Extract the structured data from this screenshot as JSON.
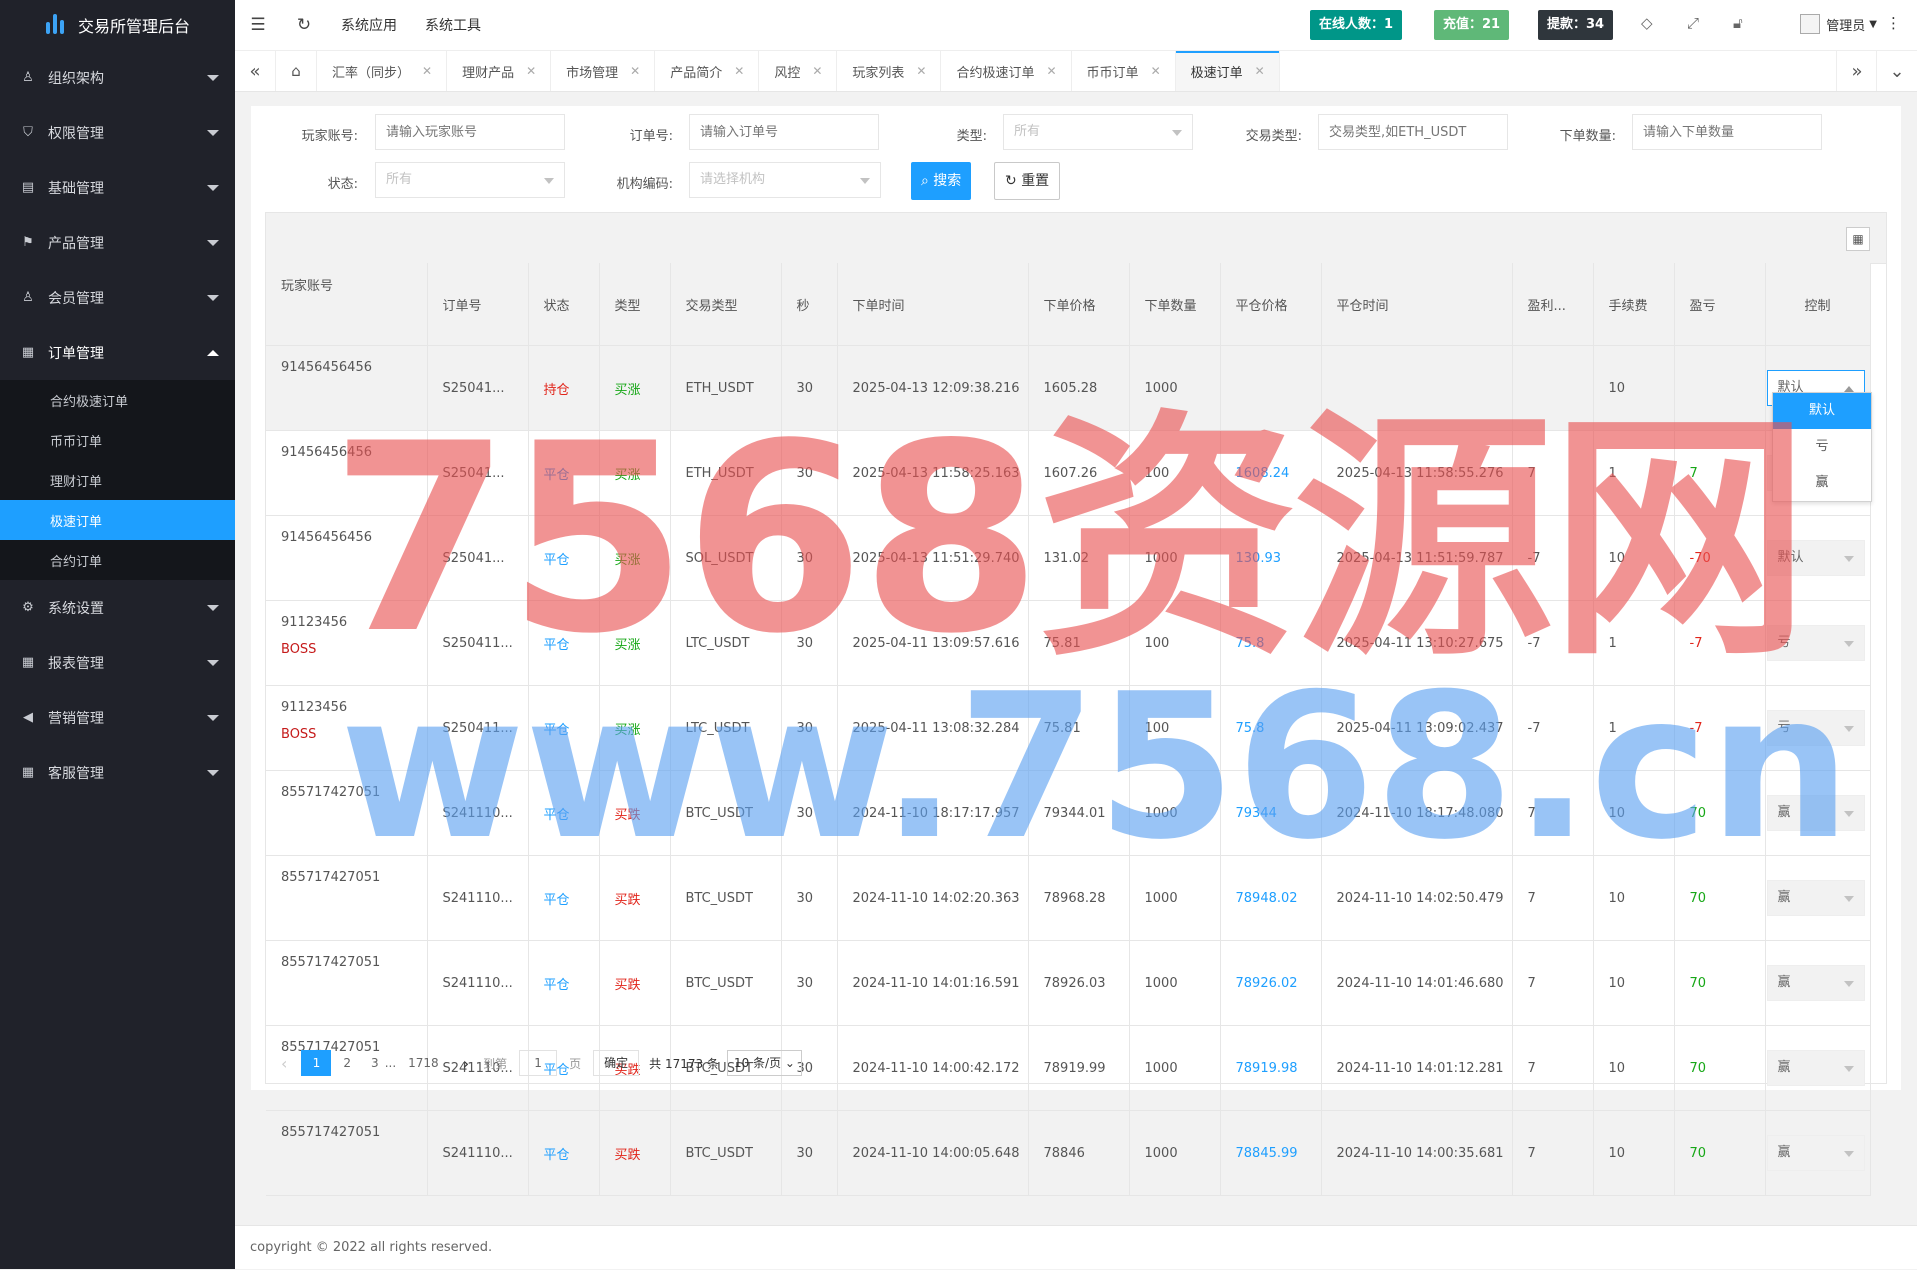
{
  "app": {
    "title": "交易所管理后台"
  },
  "sidebar": {
    "menus": [
      {
        "label": "组织架构",
        "icon": "user-icon"
      },
      {
        "label": "权限管理",
        "icon": "shield-icon"
      },
      {
        "label": "基础管理",
        "icon": "database-icon"
      },
      {
        "label": "产品管理",
        "icon": "flag-icon"
      },
      {
        "label": "会员管理",
        "icon": "person-icon"
      },
      {
        "label": "订单管理",
        "icon": "grid-icon"
      },
      {
        "label": "系统设置",
        "icon": "gear-icon"
      },
      {
        "label": "报表管理",
        "icon": "report-icon"
      },
      {
        "label": "营销管理",
        "icon": "megaphone-icon"
      },
      {
        "label": "客服管理",
        "icon": "apps-icon"
      }
    ],
    "order_sub": [
      "合约极速订单",
      "币币订单",
      "理财订单",
      "极速订单",
      "合约订单"
    ]
  },
  "header": {
    "links": [
      "系统应用",
      "系统工具"
    ],
    "online": "在线人数：1",
    "recharge": "充值：21",
    "withdraw": "提款：34",
    "admin": "管理员"
  },
  "tabs": [
    "汇率（同步）",
    "理财产品",
    "市场管理",
    "产品简介",
    "风控",
    "玩家列表",
    "合约极速订单",
    "币币订单",
    "极速订单"
  ],
  "filters": {
    "player_label": "玩家账号:",
    "player_ph": "请输入玩家账号",
    "order_label": "订单号:",
    "order_ph": "请输入订单号",
    "type_label": "类型:",
    "type_value": "所有",
    "trade_label": "交易类型:",
    "trade_ph": "交易类型,如ETH_USDT",
    "qty_label": "下单数量:",
    "qty_ph": "请输入下单数量",
    "status_label": "状态:",
    "status_value": "所有",
    "org_label": "机构编码:",
    "org_value": "请选择机构",
    "search": "搜索",
    "reset": "重置"
  },
  "table": {
    "headers": [
      "玩家账号",
      "订单号",
      "状态",
      "类型",
      "交易类型",
      "秒",
      "下单时间",
      "下单价格",
      "下单数量",
      "平仓价格",
      "平仓时间",
      "盈利...",
      "手续费",
      "盈亏",
      "控制"
    ],
    "rows": [
      {
        "acct": "91456456456",
        "tag": "",
        "order": "S25041...",
        "status": "持仓",
        "type": "买涨",
        "pair": "ETH_USDT",
        "sec": "30",
        "otime": "2025-04-13 12:09:38.216",
        "oprice": "1605.28",
        "qty": "1000",
        "cprice": "",
        "ctime": "",
        "profit": "",
        "fee": "10",
        "pnl": "",
        "ctrl": "默认"
      },
      {
        "acct": "91456456456",
        "tag": "",
        "order": "S25041...",
        "status": "平仓",
        "type": "买涨",
        "pair": "ETH_USDT",
        "sec": "30",
        "otime": "2025-04-13 11:58:25.163",
        "oprice": "1607.26",
        "qty": "100",
        "cprice": "1608.24",
        "ctime": "2025-04-13 11:58:55.276",
        "profit": "7",
        "fee": "1",
        "pnl": "7",
        "ctrl": "默认"
      },
      {
        "acct": "91456456456",
        "tag": "",
        "order": "S25041...",
        "status": "平仓",
        "type": "买涨",
        "pair": "SOL_USDT",
        "sec": "30",
        "otime": "2025-04-13 11:51:29.740",
        "oprice": "131.02",
        "qty": "1000",
        "cprice": "130.93",
        "ctime": "2025-04-13 11:51:59.787",
        "profit": "-7",
        "fee": "10",
        "pnl": "-70",
        "ctrl": "默认"
      },
      {
        "acct": "91123456",
        "tag": "BOSS",
        "order": "S250411...",
        "status": "平仓",
        "type": "买涨",
        "pair": "LTC_USDT",
        "sec": "30",
        "otime": "2025-04-11 13:09:57.616",
        "oprice": "75.81",
        "qty": "100",
        "cprice": "75.8",
        "ctime": "2025-04-11 13:10:27.675",
        "profit": "-7",
        "fee": "1",
        "pnl": "-7",
        "ctrl": "亏"
      },
      {
        "acct": "91123456",
        "tag": "BOSS",
        "order": "S250411...",
        "status": "平仓",
        "type": "买涨",
        "pair": "LTC_USDT",
        "sec": "30",
        "otime": "2025-04-11 13:08:32.284",
        "oprice": "75.81",
        "qty": "100",
        "cprice": "75.8",
        "ctime": "2025-04-11 13:09:02.437",
        "profit": "-7",
        "fee": "1",
        "pnl": "-7",
        "ctrl": "亏"
      },
      {
        "acct": "855717427051",
        "tag": "",
        "order": "S241110...",
        "status": "平仓",
        "type": "买跌",
        "pair": "BTC_USDT",
        "sec": "30",
        "otime": "2024-11-10 18:17:17.957",
        "oprice": "79344.01",
        "qty": "1000",
        "cprice": "79344",
        "ctime": "2024-11-10 18:17:48.080",
        "profit": "7",
        "fee": "10",
        "pnl": "70",
        "ctrl": "赢"
      },
      {
        "acct": "855717427051",
        "tag": "",
        "order": "S241110...",
        "status": "平仓",
        "type": "买跌",
        "pair": "BTC_USDT",
        "sec": "30",
        "otime": "2024-11-10 14:02:20.363",
        "oprice": "78968.28",
        "qty": "1000",
        "cprice": "78948.02",
        "ctime": "2024-11-10 14:02:50.479",
        "profit": "7",
        "fee": "10",
        "pnl": "70",
        "ctrl": "赢"
      },
      {
        "acct": "855717427051",
        "tag": "",
        "order": "S241110...",
        "status": "平仓",
        "type": "买跌",
        "pair": "BTC_USDT",
        "sec": "30",
        "otime": "2024-11-10 14:01:16.591",
        "oprice": "78926.03",
        "qty": "1000",
        "cprice": "78926.02",
        "ctime": "2024-11-10 14:01:46.680",
        "profit": "7",
        "fee": "10",
        "pnl": "70",
        "ctrl": "赢"
      },
      {
        "acct": "855717427051",
        "tag": "",
        "order": "S241110...",
        "status": "平仓",
        "type": "买跌",
        "pair": "BTC_USDT",
        "sec": "30",
        "otime": "2024-11-10 14:00:42.172",
        "oprice": "78919.99",
        "qty": "1000",
        "cprice": "78919.98",
        "ctime": "2024-11-10 14:01:12.281",
        "profit": "7",
        "fee": "10",
        "pnl": "70",
        "ctrl": "赢"
      },
      {
        "acct": "855717427051",
        "tag": "",
        "order": "S241110...",
        "status": "平仓",
        "type": "买跌",
        "pair": "BTC_USDT",
        "sec": "30",
        "otime": "2024-11-10 14:00:05.648",
        "oprice": "78846",
        "qty": "1000",
        "cprice": "78845.99",
        "ctime": "2024-11-10 14:00:35.681",
        "profit": "7",
        "fee": "10",
        "pnl": "70",
        "ctrl": "赢"
      }
    ]
  },
  "dropdown_options": [
    "默认",
    "亏",
    "赢"
  ],
  "pager": {
    "pages": [
      "1",
      "2",
      "3"
    ],
    "ellipsis": "...",
    "last": "1718",
    "goto": "到第",
    "goto_value": "1",
    "page_unit": "页",
    "confirm": "确定",
    "total": "共 17173 条",
    "size": "10 条/页"
  },
  "footer": "copyright © 2022 all rights reserved.",
  "watermark": {
    "line1": "7568资源网",
    "line2": "www.7568.cn"
  },
  "colors": {
    "sidebar": "#20222a",
    "accent": "#1e9fff",
    "online": "#009688",
    "recharge": "#5fb878",
    "withdraw": "#2f363c"
  }
}
